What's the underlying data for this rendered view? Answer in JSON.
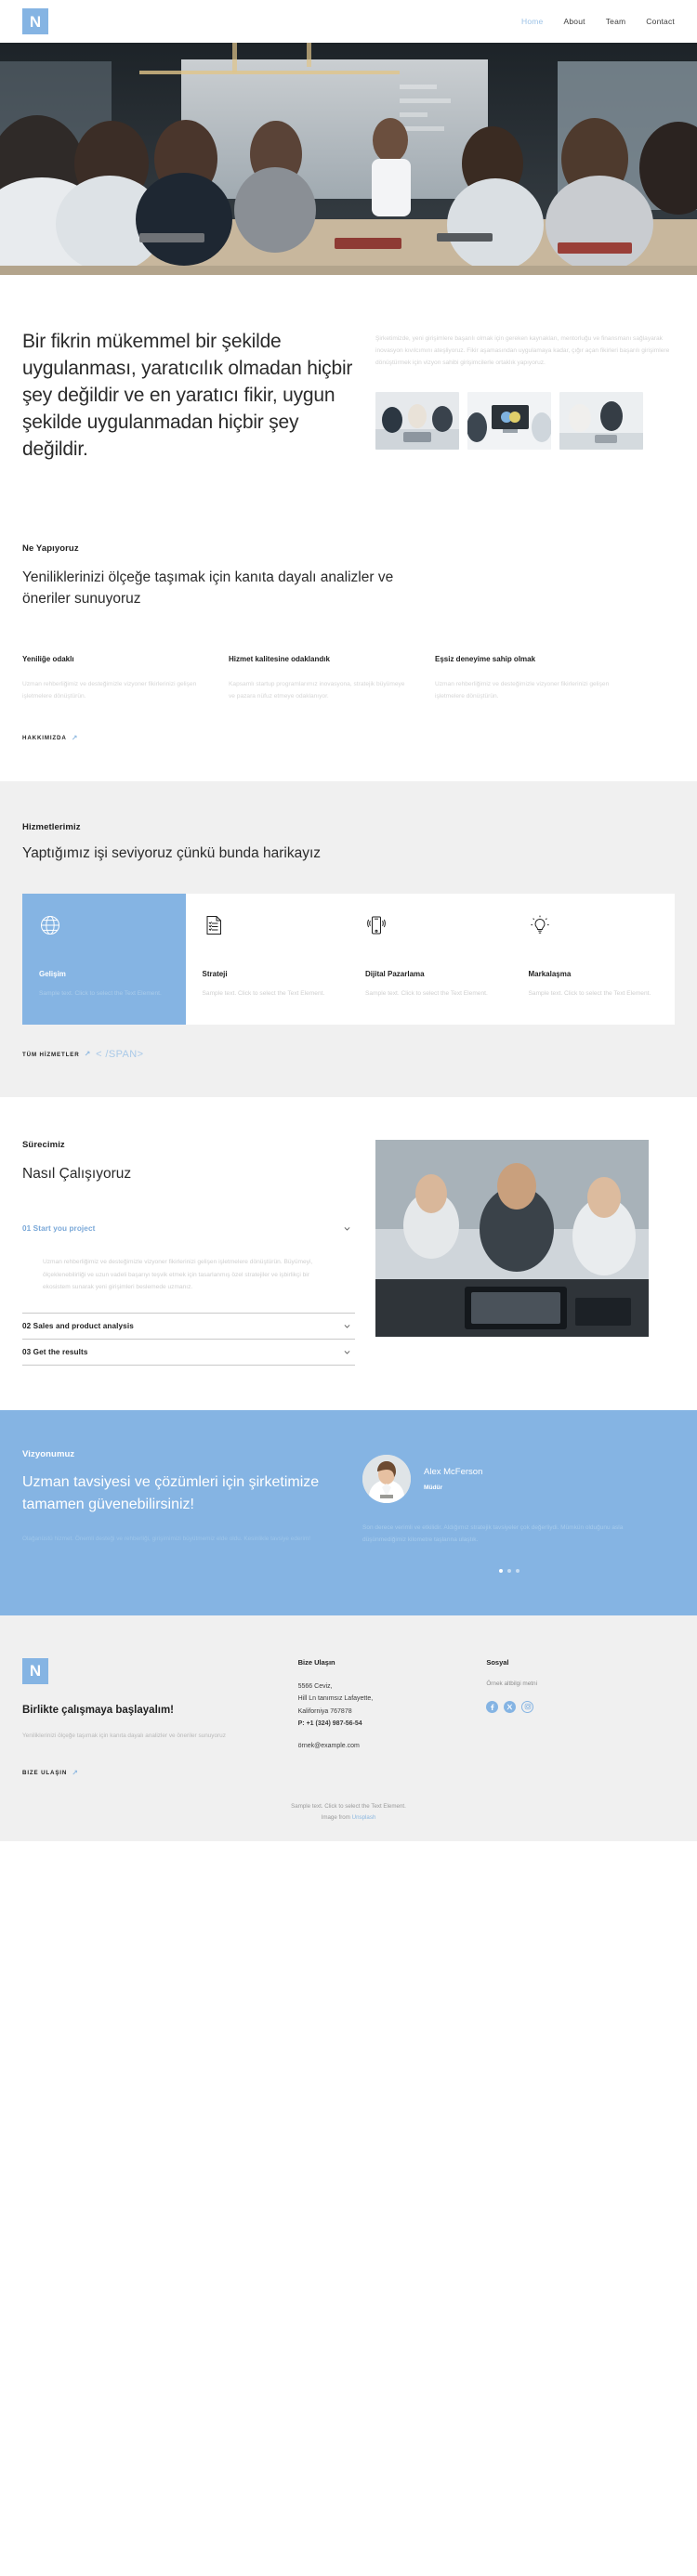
{
  "brand": {
    "logo_letter": "N",
    "accent": "#85b4e3",
    "muted": "#d2d2d2",
    "bg_gray": "#f0f0f0"
  },
  "header": {
    "nav": [
      {
        "label": "Home",
        "active": true
      },
      {
        "label": "About",
        "active": false
      },
      {
        "label": "Team",
        "active": false
      },
      {
        "label": "Contact",
        "active": false
      }
    ]
  },
  "intro": {
    "heading": "Bir fikrin mükemmel bir şekilde uygulanması, yaratıcılık olmadan hiçbir şey değildir ve en yaratıcı fikir, uygun şekilde uygulanmadan hiçbir şey değildir.",
    "paragraph": "Şirketimizde, yeni girişimlere başarılı olmak için gereken kaynakları, mentorluğu ve finansmanı sağlayarak inovasyon kıvılcımını ateşliyoruz. Fikir aşamasından uygulamaya kadar, çığır açan fikirleri başarılı girişimlere dönüştürmek için vizyon sahibi girişimcilerle ortaklık yapıyoruz."
  },
  "whatwedo": {
    "eyebrow": "Ne Yapıyoruz",
    "title": "Yeniliklerinizi ölçeğe taşımak için kanıta dayalı analizler ve öneriler sunuyoruz",
    "features": [
      {
        "title": "Yeniliğe odaklı",
        "text": "Uzman rehberliğimiz ve desteğimizle vizyoner fikirlerinizi gelişen işletmelere dönüştürün."
      },
      {
        "title": "Hizmet kalitesine odaklandık",
        "text": "Kapsamlı startup programlarımız inovasyona, stratejik büyümeye ve pazara nüfuz etmeye odaklanıyor."
      },
      {
        "title": "Eşsiz deneyime sahip olmak",
        "text": "Uzman rehberliğimiz ve desteğimizle vizyoner fikirlerinizi gelişen işletmelere dönüştürün."
      }
    ],
    "more_label": "HAKKIMIZDA"
  },
  "services": {
    "eyebrow": "Hizmetlerimiz",
    "title": "Yaptığımız işi seviyoruz çünkü bunda harikayız",
    "cards": [
      {
        "icon": "globe-icon",
        "title": "Gelişim",
        "text": "Sample text. Click to select the Text Element.",
        "active": true
      },
      {
        "icon": "document-list-icon",
        "title": "Strateji",
        "text": "Sample text. Click to select the Text Element.",
        "active": false
      },
      {
        "icon": "mobile-signal-icon",
        "title": "Dijital Pazarlama",
        "text": "Sample text. Click to select the Text Element.",
        "active": false
      },
      {
        "icon": "lightbulb-icon",
        "title": "Markalaşma",
        "text": "Sample text. Click to select the Text Element.",
        "active": false
      }
    ],
    "more_label": "TÜM HİZMETLER",
    "span_artifact": "< /SPAN>"
  },
  "process": {
    "eyebrow": "Sürecimiz",
    "title": "Nasıl Çalışıyoruz",
    "items": [
      {
        "title": "01 Start you project",
        "open": true,
        "body": "Uzman rehberliğimiz ve desteğimizle vizyoner fikirlerinizi gelişen işletmelere dönüştürün. Büyümeyi, ölçeklenebilirliği ve uzun vadeli başarıyı teşvik etmek için tasarlanmış özel stratejiler ve işbirlikçi bir ekosistem sunarak yeni girişimleri beslemede uzmanız."
      },
      {
        "title": "02 Sales and product analysis",
        "open": false,
        "body": ""
      },
      {
        "title": "03 Get the results",
        "open": false,
        "body": ""
      }
    ]
  },
  "vision": {
    "eyebrow": "Vizyonumuz",
    "title": "Uzman tavsiyesi ve çözümleri için şirketimize tamamen güvenebilirsiniz!",
    "subtext": "Olağanüstü hizmet. Önemli desteği ve rehberliği, girişimimizi büyütmemiz elde oldu. Kesinlikle tavsiye ederim!",
    "person_name": "Alex McFerson",
    "person_role": "Müdür",
    "quote": "Son derece verimli ve etkilidir. Aldığımız stratejik tavsiyeler çok değerliydi. Mümkün olduğunu asla düşünmediğimiz kilometre taşlarına ulaştık.",
    "dots": [
      true,
      false,
      false
    ]
  },
  "footer": {
    "logo_letter": "N",
    "cta_title": "Birlikte çalışmaya başlayalım!",
    "cta_text": "Yeniliklerinizi ölçeğe taşımak için kanıta dayalı analizler ve öneriler sunuyoruz",
    "cta_link": "BIZE ULAŞIN",
    "contact": {
      "heading": "Bize Ulaşın",
      "line1": "5566 Ceviz,",
      "line2": "Hill Ln tanımsız Lafayette,",
      "line3": "Kaliforniya 767878",
      "phone": "P: +1 (324) 987-56-54",
      "email": "örnek@example.com"
    },
    "social": {
      "heading": "Sosyal",
      "note": "Örnek altbilgi metni",
      "icons": [
        "facebook-icon",
        "x-twitter-icon",
        "instagram-icon"
      ]
    },
    "copyright_line1": "Sample text. Click to select the Text Element.",
    "copyright_line2_prefix": "Image from ",
    "copyright_line2_link": "Unsplash"
  }
}
